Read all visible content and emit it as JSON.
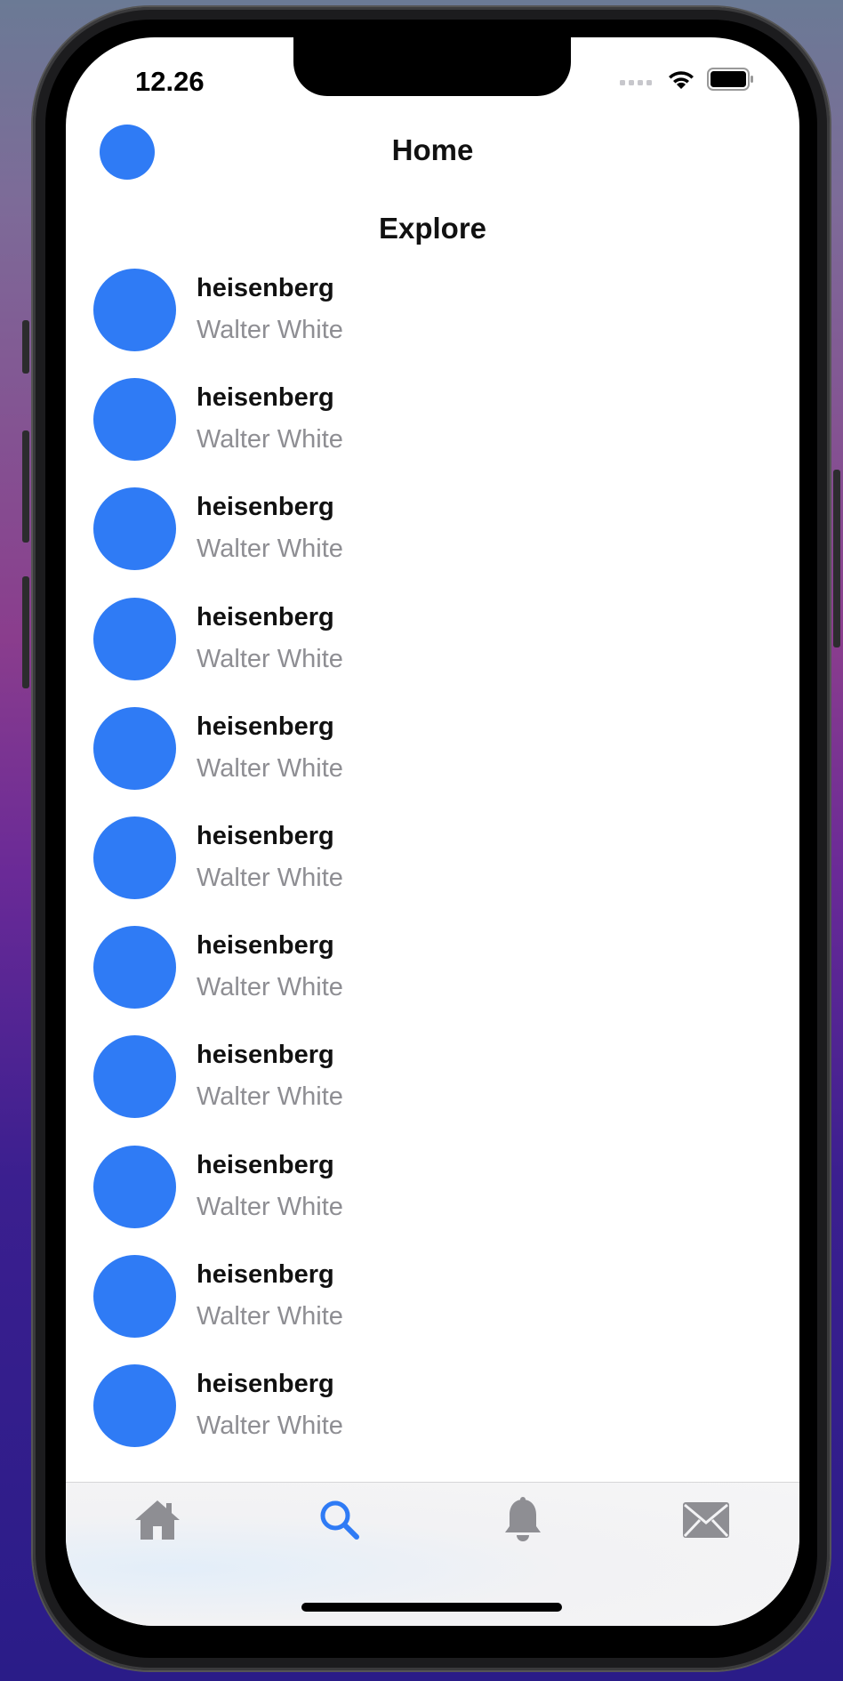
{
  "status_bar": {
    "time": "12.26"
  },
  "header": {
    "title": "Home"
  },
  "section": {
    "title": "Explore"
  },
  "users": [
    {
      "handle": "heisenberg",
      "name": "Walter White"
    },
    {
      "handle": "heisenberg",
      "name": "Walter White"
    },
    {
      "handle": "heisenberg",
      "name": "Walter White"
    },
    {
      "handle": "heisenberg",
      "name": "Walter White"
    },
    {
      "handle": "heisenberg",
      "name": "Walter White"
    },
    {
      "handle": "heisenberg",
      "name": "Walter White"
    },
    {
      "handle": "heisenberg",
      "name": "Walter White"
    },
    {
      "handle": "heisenberg",
      "name": "Walter White"
    },
    {
      "handle": "heisenberg",
      "name": "Walter White"
    },
    {
      "handle": "heisenberg",
      "name": "Walter White"
    },
    {
      "handle": "heisenberg",
      "name": "Walter White"
    }
  ],
  "tabs": [
    {
      "icon": "home-icon",
      "active": false
    },
    {
      "icon": "search-icon",
      "active": true
    },
    {
      "icon": "bell-icon",
      "active": false
    },
    {
      "icon": "envelope-icon",
      "active": false
    }
  ],
  "colors": {
    "accent": "#2f7bf5",
    "inactive_icon": "#8e8e93",
    "secondary_text": "#8e8e93"
  }
}
